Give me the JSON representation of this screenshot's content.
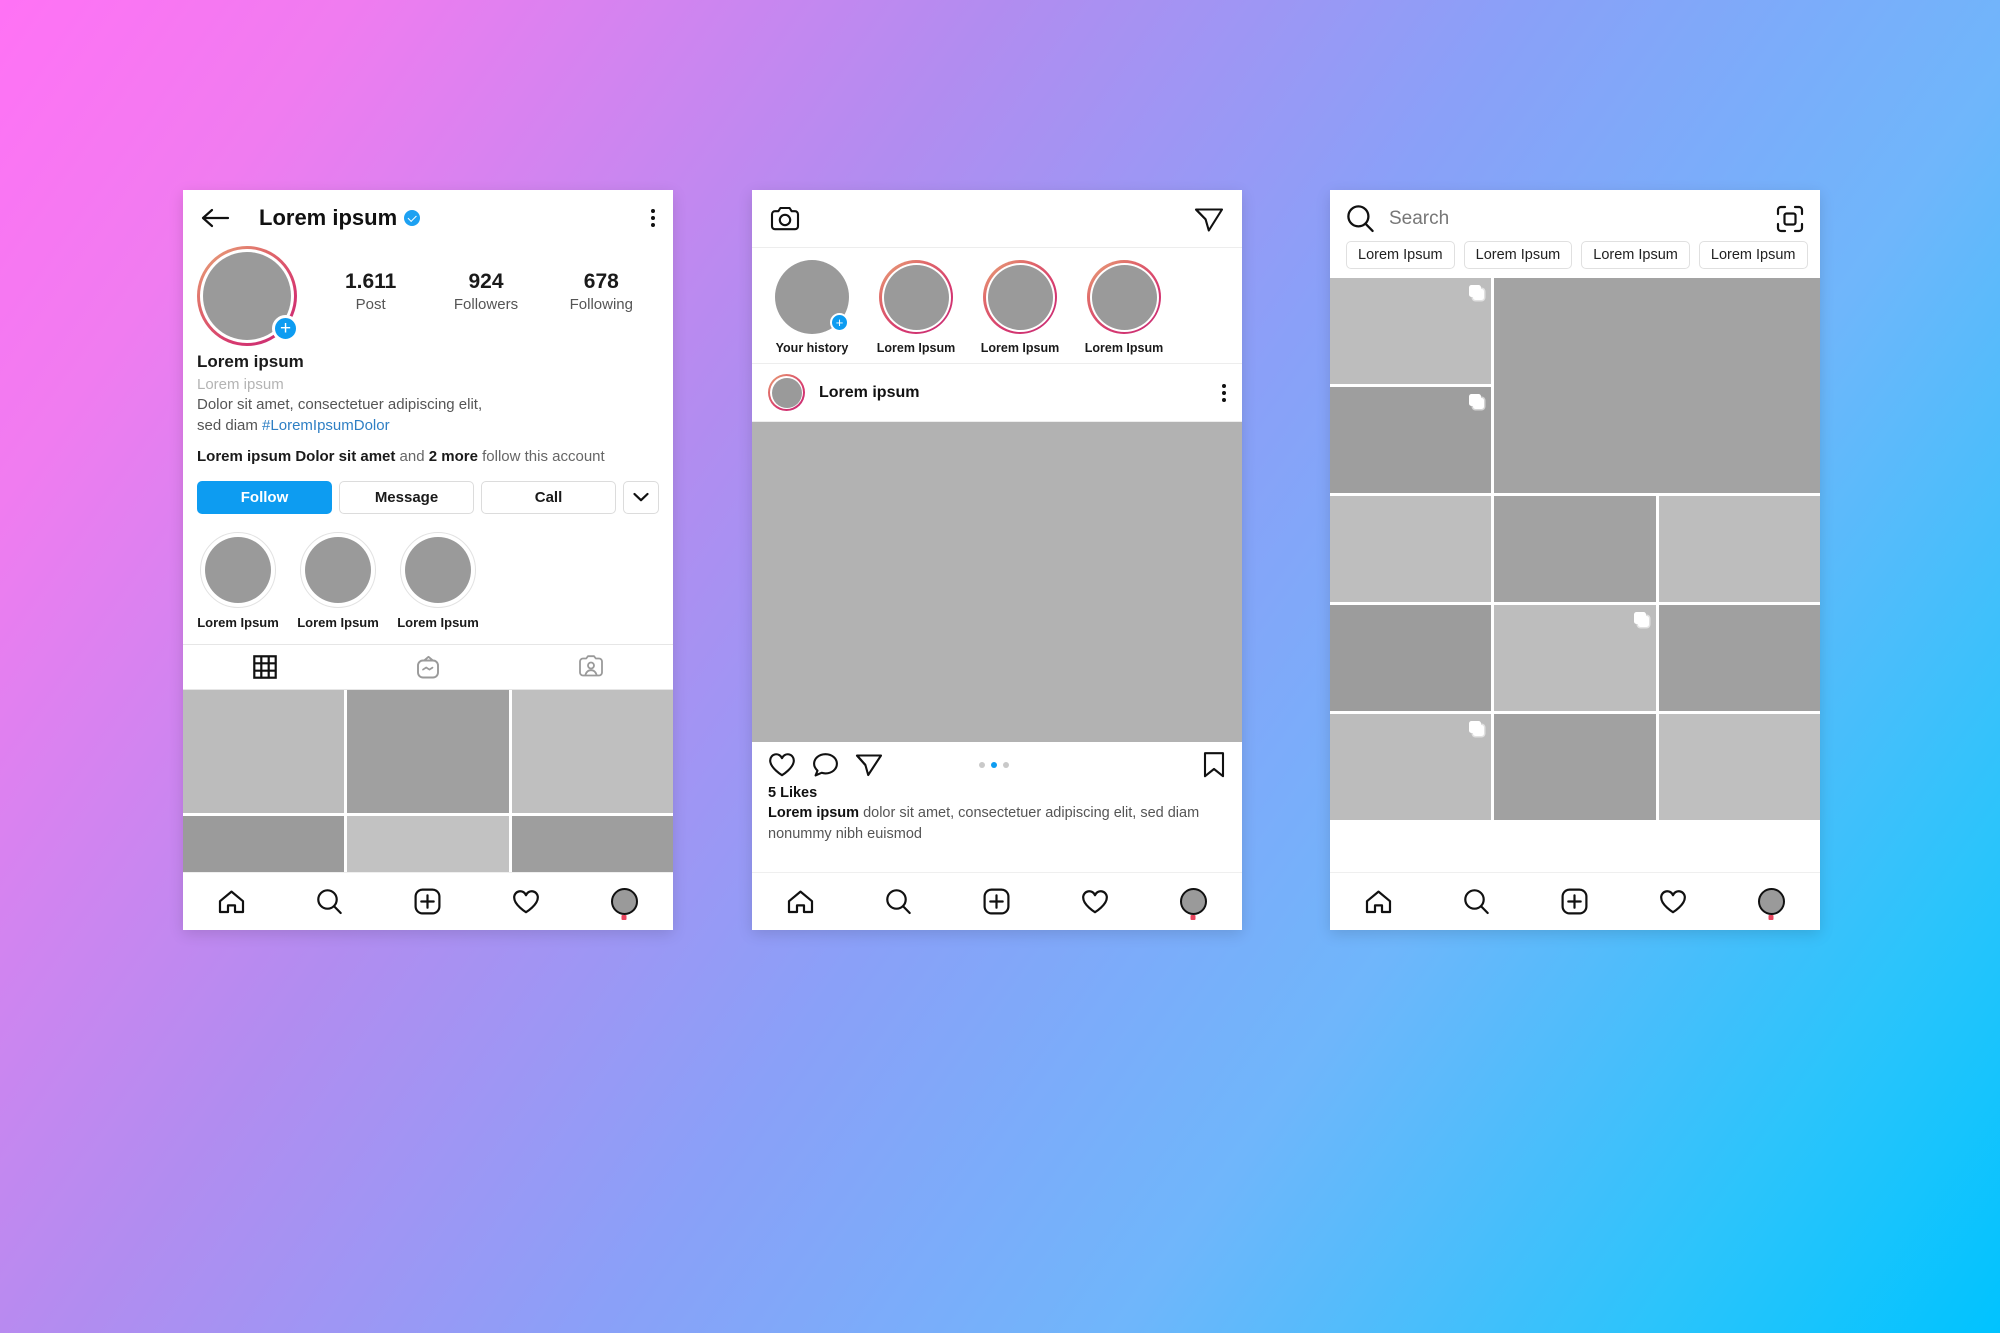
{
  "background": {
    "from": "#ff72f5",
    "to": "#00c3ff"
  },
  "accent": {
    "blue": "#0d9cf1",
    "link": "#2e7fc4",
    "story_ring_from": "#e8a87c",
    "story_ring_to": "#c62d74",
    "dot_red": "#e8455e"
  },
  "profile_screen": {
    "back_icon": "arrow-left-icon",
    "title": "Lorem ipsum",
    "verified_icon": "verified-badge-icon",
    "menu_icon": "kebab-menu-icon",
    "avatar_plus_label": "+",
    "stats": [
      {
        "num": "1.611",
        "label": "Post"
      },
      {
        "num": "924",
        "label": "Followers"
      },
      {
        "num": "678",
        "label": "Following"
      }
    ],
    "bio": {
      "name": "Lorem ipsum",
      "category": "Lorem ipsum",
      "desc_line1": "Dolor sit amet, consectetuer adipiscing elit,",
      "desc_line2_prefix": "sed diam ",
      "hashtag": "#LoremIpsumDolor",
      "follows_bold1": "Lorem ipsum Dolor sit amet",
      "follows_mid": " and ",
      "follows_bold2": "2 more",
      "follows_tail": " follow this account"
    },
    "actions": {
      "follow": "Follow",
      "message": "Message",
      "call": "Call",
      "more_icon": "chevron-down-icon"
    },
    "highlights": [
      {
        "label": "Lorem Ipsum"
      },
      {
        "label": "Lorem Ipsum"
      },
      {
        "label": "Lorem Ipsum"
      }
    ],
    "tabs": [
      {
        "icon": "grid-icon",
        "active": true
      },
      {
        "icon": "igtv-icon",
        "active": false
      },
      {
        "icon": "tagged-icon",
        "active": false
      }
    ],
    "grid_tones": [
      "#bcbcbc",
      "#a0a0a0",
      "#bfbfbf",
      "#9b9b9b",
      "#c2c2c2",
      "#9e9e9e"
    ],
    "bottom_nav": [
      "home-icon",
      "search-icon",
      "add-post-icon",
      "heart-icon",
      "profile-avatar-icon"
    ]
  },
  "feed_screen": {
    "camera_icon": "camera-icon",
    "direct_icon": "paper-plane-icon",
    "stories": [
      {
        "label": "Your history",
        "own": true
      },
      {
        "label": "Lorem Ipsum",
        "own": false
      },
      {
        "label": "Lorem Ipsum",
        "own": false
      },
      {
        "label": "Lorem Ipsum",
        "own": false
      }
    ],
    "post": {
      "author": "Lorem ipsum",
      "menu_icon": "kebab-menu-icon",
      "image_tone": "#b2b2b2",
      "actions": [
        "heart-icon",
        "comment-icon",
        "share-icon"
      ],
      "save_icon": "bookmark-icon",
      "carousel_dots": 3,
      "carousel_active_index": 1,
      "likes": "5 Likes",
      "caption_author": "Lorem ipsum",
      "caption_text": " dolor sit amet, consectetuer adipiscing elit, sed diam nonummy nibh euismod"
    },
    "bottom_nav": [
      "home-icon",
      "search-icon",
      "add-post-icon",
      "heart-icon",
      "profile-avatar-icon"
    ]
  },
  "explore_screen": {
    "search_icon": "search-icon",
    "search_placeholder": "Search",
    "scan_icon": "nametag-scan-icon",
    "chips": [
      "Lorem Ipsum",
      "Lorem Ipsum",
      "Lorem Ipsum",
      "Lorem Ipsum"
    ],
    "cells": [
      {
        "tone": "#bdbdbd",
        "span": 1,
        "rows": 1,
        "multi": true
      },
      {
        "tone": "#a3a3a3",
        "span": 2,
        "rows": 2,
        "multi": false
      },
      {
        "tone": "#9e9e9e",
        "span": 1,
        "rows": 1,
        "multi": true
      },
      {
        "tone": "#bebebe",
        "span": 1,
        "rows": 1,
        "multi": false
      },
      {
        "tone": "#a2a2a2",
        "span": 1,
        "rows": 1,
        "multi": false
      },
      {
        "tone": "#bdbdbd",
        "span": 1,
        "rows": 1,
        "multi": false
      },
      {
        "tone": "#9c9c9c",
        "span": 1,
        "rows": 1,
        "multi": false
      },
      {
        "tone": "#bdbdbd",
        "span": 1,
        "rows": 1,
        "multi": true
      },
      {
        "tone": "#a0a0a0",
        "span": 1,
        "rows": 1,
        "multi": false
      },
      {
        "tone": "#bcbcbc",
        "span": 1,
        "rows": 1,
        "multi": true
      },
      {
        "tone": "#a1a1a1",
        "span": 1,
        "rows": 1,
        "multi": false
      },
      {
        "tone": "#bfbfbf",
        "span": 1,
        "rows": 1,
        "multi": false
      }
    ],
    "bottom_nav": [
      "home-icon",
      "search-icon",
      "add-post-icon",
      "heart-icon",
      "profile-avatar-icon"
    ]
  }
}
